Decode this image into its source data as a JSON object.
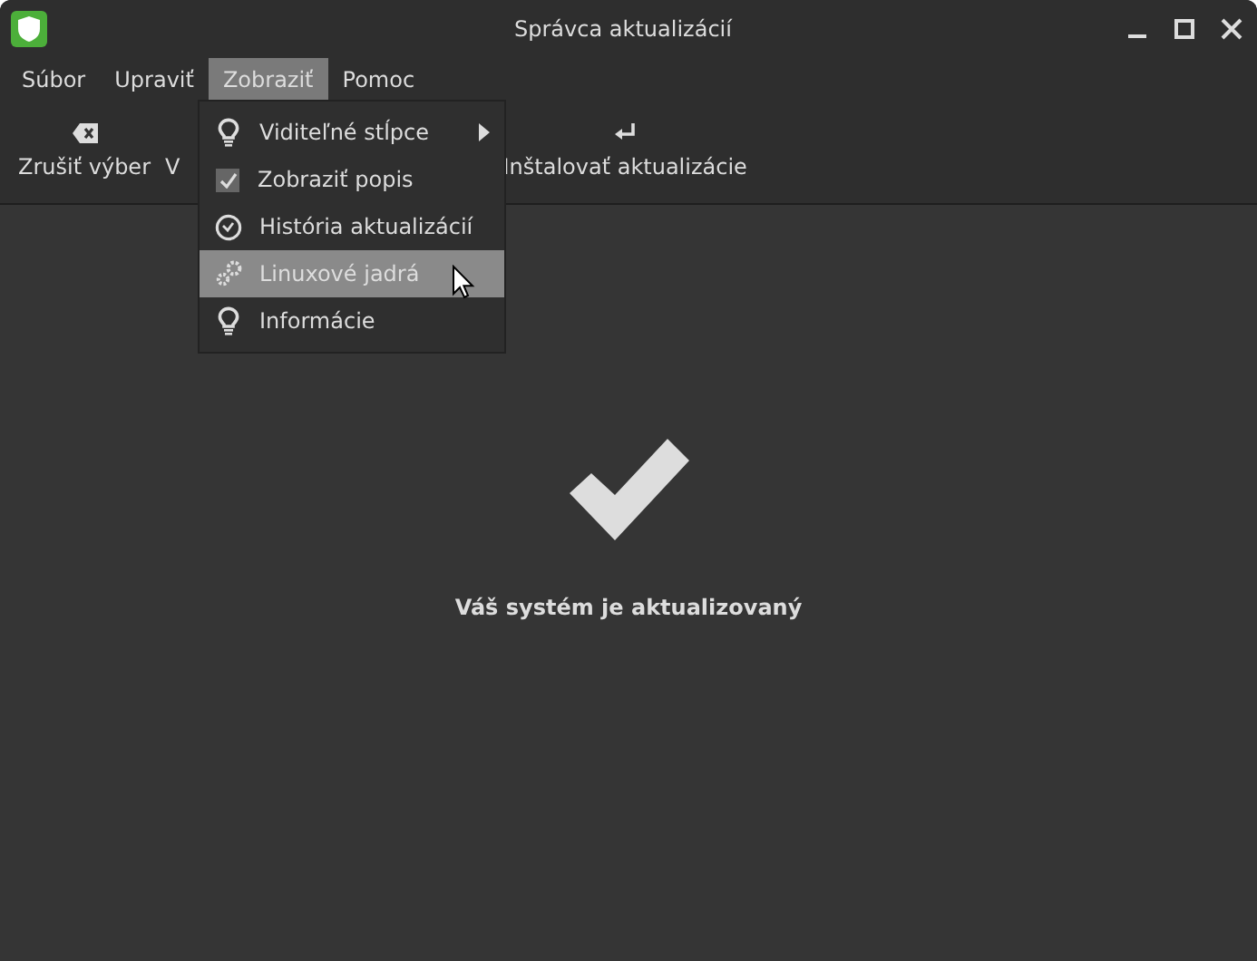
{
  "window": {
    "title": "Správca aktualizácií"
  },
  "menubar": [
    {
      "label": "Súbor",
      "selected": false
    },
    {
      "label": "Upraviť",
      "selected": false
    },
    {
      "label": "Zobraziť",
      "selected": true
    },
    {
      "label": "Pomoc",
      "selected": false
    }
  ],
  "toolbar": [
    {
      "label": "Zrušiť výber",
      "kind": "clear"
    },
    {
      "label": "V",
      "kind": "plain"
    },
    {
      "label": "Inštalovať aktualizácie",
      "kind": "install"
    }
  ],
  "dropdown": [
    {
      "label": "Viditeľné stĺpce",
      "kind": "submenu",
      "selected": false
    },
    {
      "label": "Zobraziť popis",
      "kind": "checkbox",
      "checked": true,
      "selected": false
    },
    {
      "label": "História aktualizácií",
      "kind": "clock",
      "selected": false
    },
    {
      "label": "Linuxové jadrá",
      "kind": "gears",
      "selected": true
    },
    {
      "label": "Informácie",
      "kind": "bulb",
      "selected": false
    }
  ],
  "status": {
    "message": "Váš systém je aktualizovaný"
  }
}
